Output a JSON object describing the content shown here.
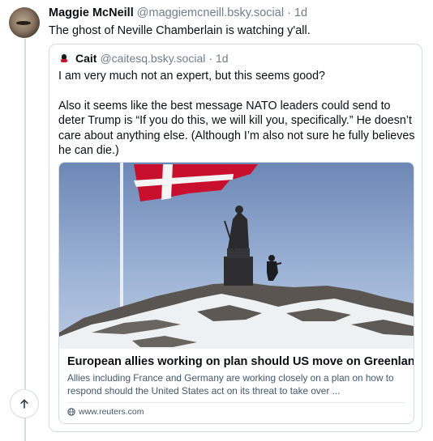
{
  "post": {
    "author_name": "Maggie McNeill",
    "handle": "@maggiemcneill.bsky.social",
    "separator": "·",
    "time": "1d",
    "text": "The ghost of Neville Chamberlain is watching y'all."
  },
  "quote": {
    "author_name": "Cait",
    "handle": "@caitesq.bsky.social",
    "separator": "·",
    "time": "1d",
    "paragraph1": "I am very much not an expert, but this seems good?",
    "paragraph2": "Also it seems like the best message NATO leaders could send to deter Trump is “If you do this, we will kill you, specifically.” He doesn’t care about anything else. (Although I’m also not sure he fully believes he can die.)",
    "link_card": {
      "title": "European allies working on plan should US move on Greenland",
      "description": "Allies including France and Germany are working closely on a plan on how to respond should the United States act on its threat to take over ...",
      "domain": "www.reuters.com",
      "image_icon": "photo-flag-statue-icon"
    }
  },
  "icons": {
    "scroll_top": "arrow-up-icon",
    "domain": "globe-icon"
  },
  "colors": {
    "border": "#d4dbe2",
    "muted_text": "#6f7d8c",
    "flag_red": "#c8102e"
  }
}
